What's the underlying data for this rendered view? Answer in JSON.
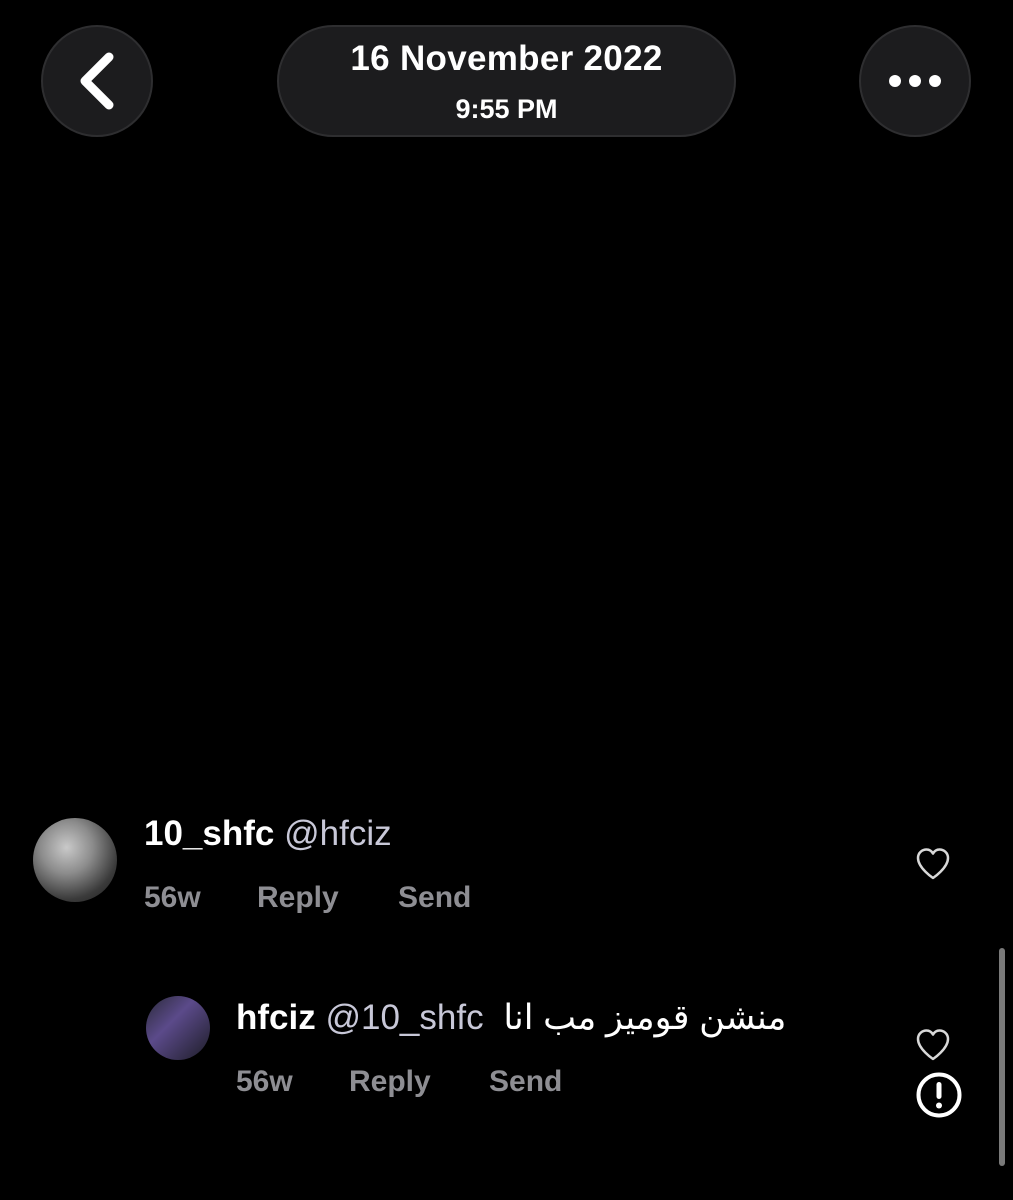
{
  "header": {
    "back_icon": "chevron-left-icon",
    "date": "16 November 2022",
    "time": "9:55 PM",
    "more_icon": "ellipsis-icon"
  },
  "comments": [
    {
      "username": "10_shfc",
      "mention": "@hfciz",
      "text": "",
      "age": "56w",
      "reply_label": "Reply",
      "send_label": "Send",
      "like_icon": "heart-icon"
    },
    {
      "username": "hfciz",
      "mention": "@10_shfc",
      "text": "منشن قوميز مب انا",
      "age": "56w",
      "reply_label": "Reply",
      "send_label": "Send",
      "like_icon": "heart-icon"
    }
  ],
  "colors": {
    "background": "#000000",
    "button_bg": "#1c1c1e",
    "meta_text": "#8e8e93"
  }
}
